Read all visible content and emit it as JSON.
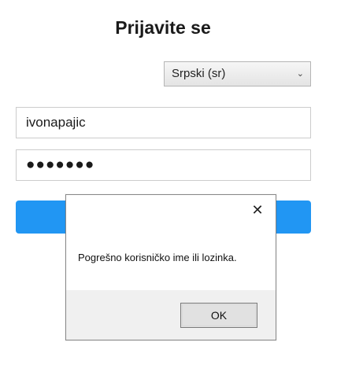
{
  "login": {
    "title": "Prijavite se",
    "language": {
      "selected": "Srpski (sr)"
    },
    "username_value": "ivonapajic",
    "password_mask": "●●●●●●●",
    "colors": {
      "button": "#2196f3"
    }
  },
  "dialog": {
    "message": "Pogrešno korisničko ime ili lozinka.",
    "ok_label": "OK",
    "close_glyph": "✕"
  }
}
